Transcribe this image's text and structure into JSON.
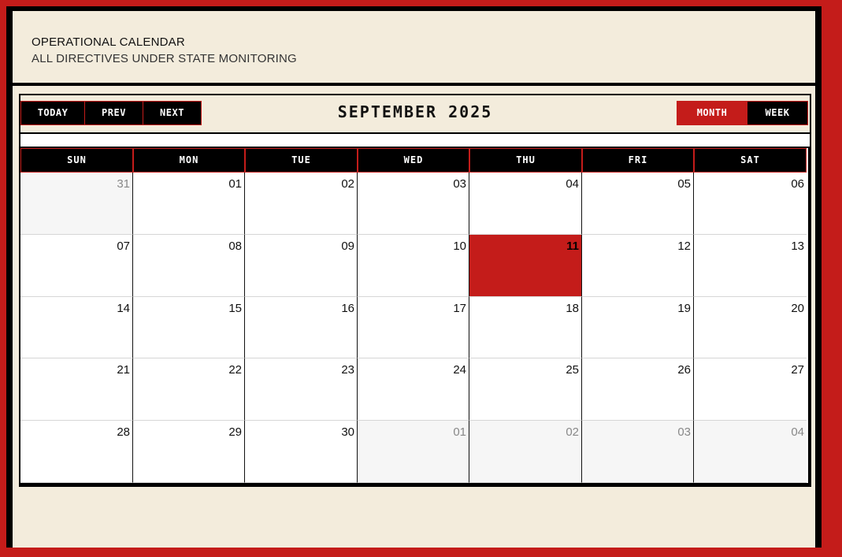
{
  "header": {
    "title": "OPERATIONAL CALENDAR",
    "subtitle": "ALL DIRECTIVES UNDER STATE MONITORING"
  },
  "toolbar": {
    "today_label": "TODAY",
    "prev_label": "PREV",
    "next_label": "NEXT",
    "month_title": "SEPTEMBER 2025",
    "month_view_label": "MONTH",
    "week_view_label": "WEEK",
    "active_view": "month"
  },
  "weekdays": [
    "SUN",
    "MON",
    "TUE",
    "WED",
    "THU",
    "FRI",
    "SAT"
  ],
  "weeks": [
    [
      {
        "d": "31",
        "other": true
      },
      {
        "d": "01"
      },
      {
        "d": "02"
      },
      {
        "d": "03"
      },
      {
        "d": "04"
      },
      {
        "d": "05"
      },
      {
        "d": "06"
      }
    ],
    [
      {
        "d": "07"
      },
      {
        "d": "08"
      },
      {
        "d": "09"
      },
      {
        "d": "10"
      },
      {
        "d": "11",
        "today": true
      },
      {
        "d": "12"
      },
      {
        "d": "13"
      }
    ],
    [
      {
        "d": "14"
      },
      {
        "d": "15"
      },
      {
        "d": "16"
      },
      {
        "d": "17"
      },
      {
        "d": "18"
      },
      {
        "d": "19"
      },
      {
        "d": "20"
      }
    ],
    [
      {
        "d": "21"
      },
      {
        "d": "22"
      },
      {
        "d": "23"
      },
      {
        "d": "24"
      },
      {
        "d": "25"
      },
      {
        "d": "26"
      },
      {
        "d": "27"
      }
    ],
    [
      {
        "d": "28"
      },
      {
        "d": "29"
      },
      {
        "d": "30"
      },
      {
        "d": "01",
        "other": true
      },
      {
        "d": "02",
        "other": true
      },
      {
        "d": "03",
        "other": true
      },
      {
        "d": "04",
        "other": true
      }
    ]
  ],
  "colors": {
    "accent": "#c41c1a",
    "background": "#f3ecdc",
    "header_cell": "#000000",
    "other_month_cell": "#f6f6f6"
  }
}
